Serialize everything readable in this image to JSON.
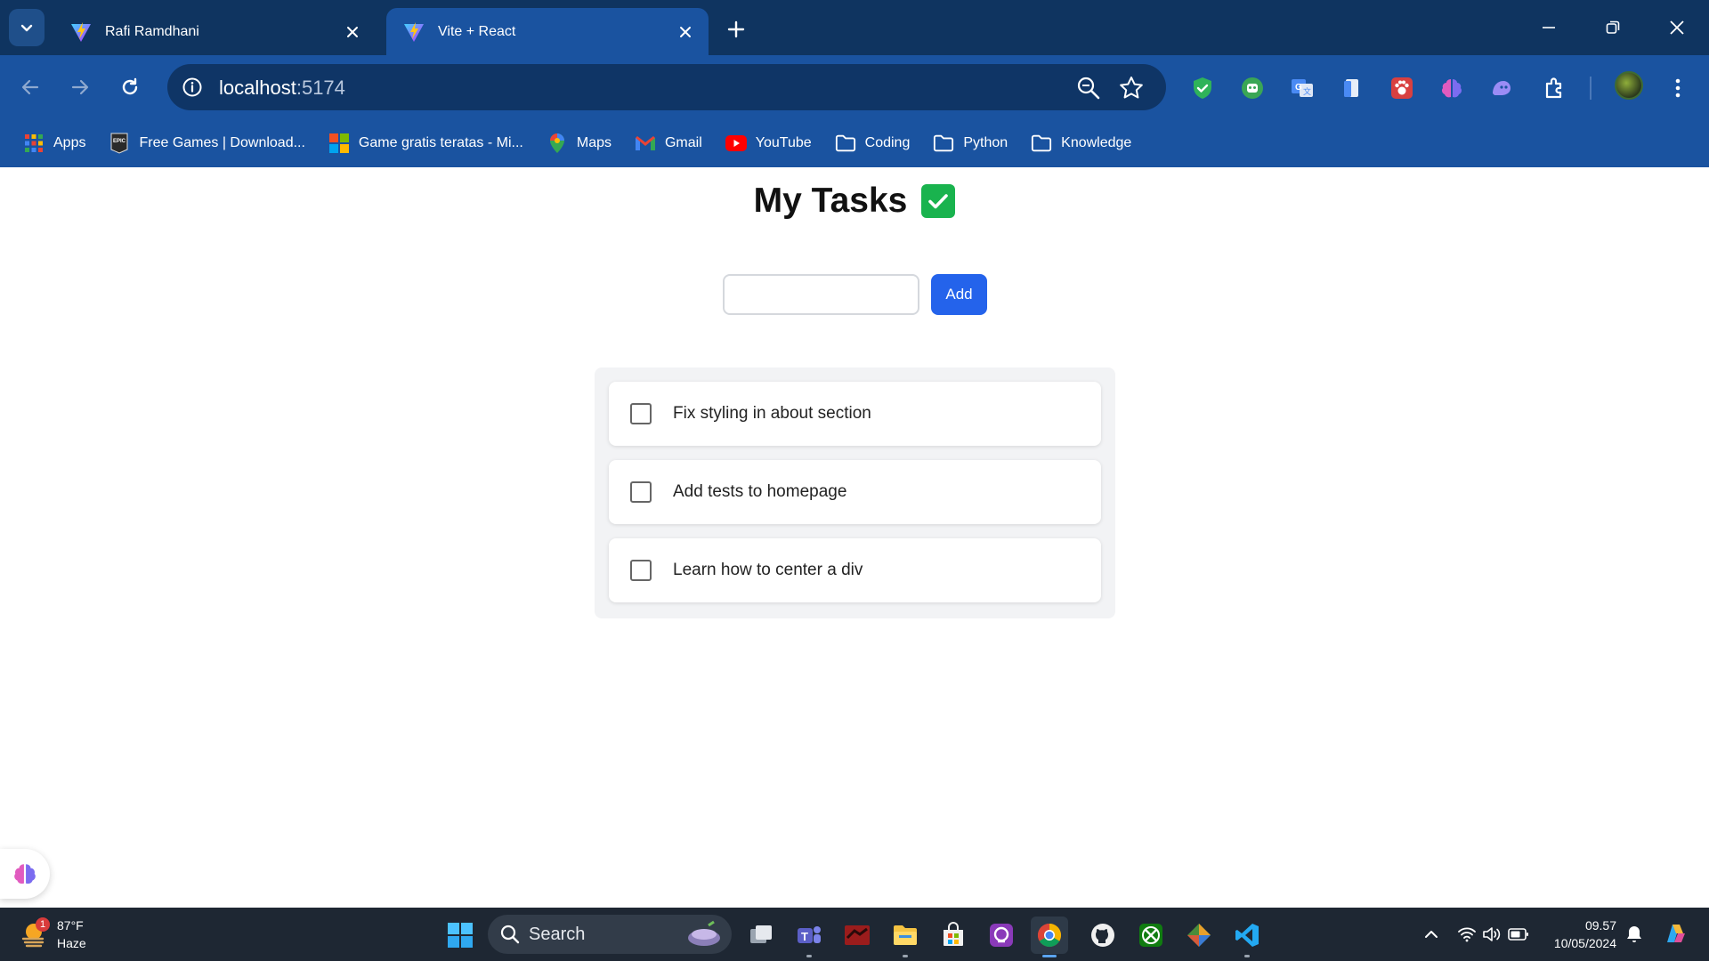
{
  "browser": {
    "tabs": [
      {
        "title": "Rafi Ramdhani",
        "active": false
      },
      {
        "title": "Vite + React",
        "active": true
      }
    ],
    "url": {
      "host": "localhost",
      "port": ":5174"
    },
    "bookmarks": [
      {
        "label": "Apps",
        "icon": "apps-grid-icon"
      },
      {
        "label": "Free Games | Download...",
        "icon": "epic-games-icon"
      },
      {
        "label": "Game gratis teratas - Mi...",
        "icon": "microsoft-store-icon"
      },
      {
        "label": "Maps",
        "icon": "maps-icon"
      },
      {
        "label": "Gmail",
        "icon": "gmail-icon"
      },
      {
        "label": "YouTube",
        "icon": "youtube-icon"
      },
      {
        "label": "Coding",
        "icon": "folder-icon"
      },
      {
        "label": "Python",
        "icon": "folder-icon"
      },
      {
        "label": "Knowledge",
        "icon": "folder-icon"
      }
    ],
    "colors": {
      "tabstrip": "#0f3460",
      "toolbar": "#1a53a0",
      "omnibox": "#0f3566"
    }
  },
  "app": {
    "title": "My Tasks",
    "title_icon": "check-mark-icon",
    "input": {
      "value": "",
      "placeholder": ""
    },
    "add_label": "Add",
    "tasks": [
      {
        "text": "Fix styling in about section",
        "done": false
      },
      {
        "text": "Add tests to homepage",
        "done": false
      },
      {
        "text": "Learn how to center a div",
        "done": false
      }
    ],
    "colors": {
      "accent": "#2463eb",
      "check_badge": "#19b34e",
      "panel": "#f2f3f5"
    }
  },
  "taskbar": {
    "weather": {
      "temp": "87°F",
      "condition": "Haze",
      "badge": "1"
    },
    "search_label": "Search",
    "clock": {
      "time": "09.57",
      "date": "10/05/2024"
    }
  }
}
